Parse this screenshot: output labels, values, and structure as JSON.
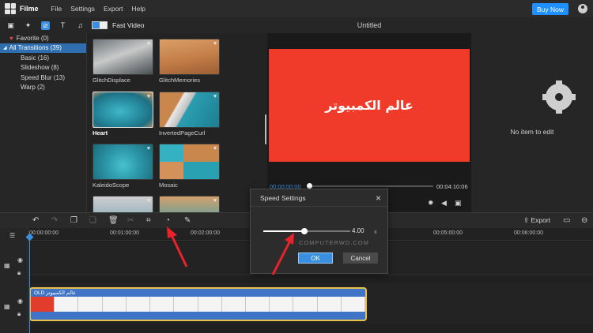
{
  "app": {
    "name": "Filme"
  },
  "menu": [
    "File",
    "Settings",
    "Export",
    "Help"
  ],
  "buy_button": "Buy Now",
  "media_toolbar": {
    "fast_video_label": "Fast Video"
  },
  "categories": [
    {
      "label": "Favorite (0)"
    },
    {
      "label": "All Transitions (39)"
    },
    {
      "label": "Basic (16)"
    },
    {
      "label": "Slideshow (8)"
    },
    {
      "label": "Speed Blur (13)"
    },
    {
      "label": "Warp (2)"
    }
  ],
  "transitions": [
    {
      "label": "GlitchDisplace"
    },
    {
      "label": "GlitchMemories"
    },
    {
      "label": "Heart"
    },
    {
      "label": "InvertedPageCurl"
    },
    {
      "label": "KaleidoScope"
    },
    {
      "label": "Mosaic"
    }
  ],
  "preview": {
    "title": "Untitled",
    "canvas_text": "عالم الكمبيوتر",
    "current_time": "00:00:00:00",
    "total_time": "00:04:10:06",
    "canvas_color": "#f03b2b"
  },
  "side_panel": {
    "empty_text": "No item to edit"
  },
  "edit_toolbar": {
    "export_label": "Export"
  },
  "timeline": {
    "ruler": [
      "00:00:00:00",
      "00:01:00:00",
      "00:02:00:00",
      "00:05:00:00",
      "00:06:00:00"
    ],
    "clip_label": "OLD عالم الكمبيوتر"
  },
  "speed_dialog": {
    "title": "Speed Settings",
    "value": "4.00",
    "unit": "x",
    "slider_fraction": 0.47,
    "ok_label": "OK",
    "cancel_label": "Cancel"
  },
  "watermark": "COMPUTERWD.COM",
  "colors": {
    "accent": "#3b8fe0",
    "clip_border": "#e8c14a",
    "arrow": "#e8232a"
  }
}
